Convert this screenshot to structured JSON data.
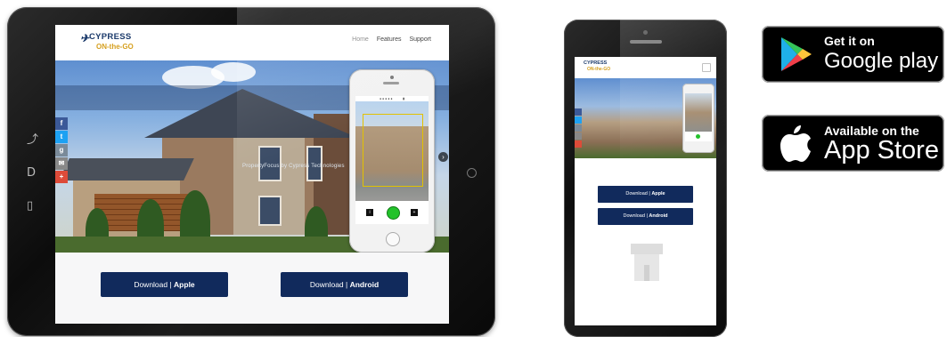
{
  "site": {
    "logo_line1": "CYPRESS",
    "logo_line2": "ON-the-GO",
    "nav": [
      "Home",
      "Features",
      "Support"
    ],
    "overlay_text": "PropertyFocus by Cypress Technologies",
    "download_apple_prefix": "Download | ",
    "download_apple_bold": "Apple",
    "download_android_prefix": "Download | ",
    "download_android_bold": "Android",
    "social": [
      "f",
      "t",
      "g",
      "✉",
      "+"
    ]
  },
  "phone_site": {
    "logo_line1": "CYPRESS",
    "logo_line2": "ON-the-GO",
    "download_apple_prefix": "Download | ",
    "download_apple_bold": "Apple",
    "download_android_prefix": "Download | ",
    "download_android_bold": "Android"
  },
  "badges": {
    "google": {
      "small": "Get it on",
      "big": "Google play"
    },
    "apple": {
      "small": "Available on the",
      "big": "App Store"
    }
  },
  "colors": {
    "button_navy": "#112a5c",
    "logo_blue": "#1b3a6b",
    "logo_gold": "#d6a020",
    "facebook": "#3b5998",
    "twitter": "#1da1f2",
    "google_plus": "#dd4b39"
  }
}
